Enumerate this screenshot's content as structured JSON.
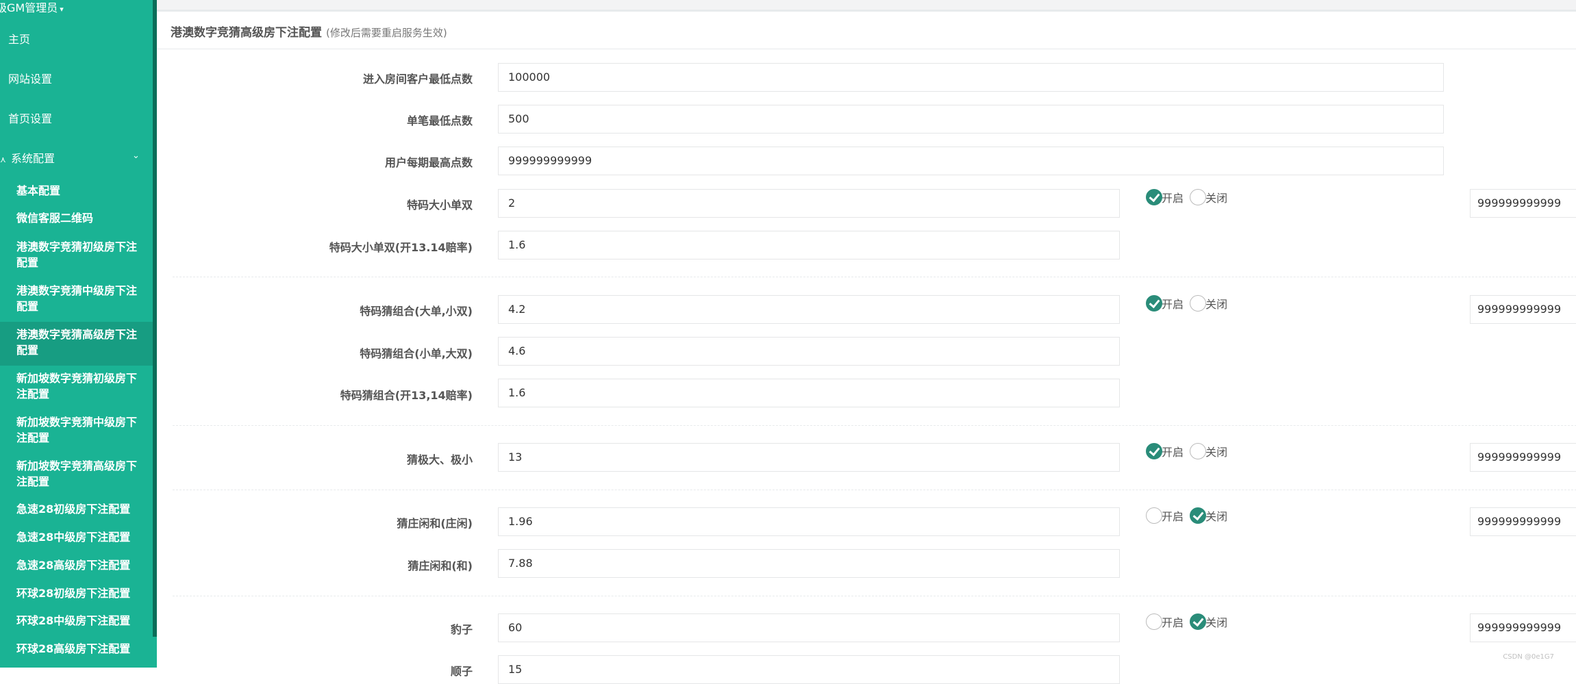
{
  "sidebar": {
    "user_label": "级GM管理员",
    "home": "主页",
    "site_settings": "网站设置",
    "homepage_settings": "首页设置",
    "system_config": "系统配置",
    "items": [
      "基本配置",
      "微信客服二维码",
      "港澳数字竞猜初级房下注配置",
      "港澳数字竞猜中级房下注配置",
      "港澳数字竞猜高级房下注配置",
      "新加坡数字竞猜初级房下注配置",
      "新加坡数字竞猜中级房下注配置",
      "新加坡数字竞猜高级房下注配置",
      "急速28初级房下注配置",
      "急速28中级房下注配置",
      "急速28高级房下注配置",
      "环球28初级房下注配置",
      "环球28中级房下注配置",
      "环球28高级房下注配置"
    ],
    "active_index": 4
  },
  "panel": {
    "title": "港澳数字竞猜高级房下注配置",
    "note": "(修改后需要重启服务生效)"
  },
  "radio_labels": {
    "on": "开启",
    "off": "关闭"
  },
  "fields": {
    "min_entry_points": {
      "label": "进入房间客户最低点数",
      "value": "100000"
    },
    "min_bet_points": {
      "label": "单笔最低点数",
      "value": "500"
    },
    "max_user_points": {
      "label": "用户每期最高点数",
      "value": "999999999999"
    },
    "special_bsoe": {
      "label": "特码大小单双",
      "value": "2",
      "enabled": true,
      "max": "999999999999"
    },
    "special_bsoe_1314": {
      "label": "特码大小单双(开13.14赔率)",
      "value": "1.6"
    },
    "combo_big_odd": {
      "label": "特码猜组合(大单,小双)",
      "value": "4.2",
      "enabled": true,
      "max": "999999999999"
    },
    "combo_small_odd": {
      "label": "特码猜组合(小单,大双)",
      "value": "4.6"
    },
    "combo_1314": {
      "label": "特码猜组合(开13,14赔率)",
      "value": "1.6"
    },
    "extreme": {
      "label": "猜极大、极小",
      "value": "13",
      "enabled": true,
      "max": "999999999999"
    },
    "banker_player": {
      "label": "猜庄闲和(庄闲)",
      "value": "1.96",
      "enabled": false,
      "max": "999999999999"
    },
    "tie": {
      "label": "猜庄闲和(和)",
      "value": "7.88"
    },
    "leopard": {
      "label": "豹子",
      "value": "60",
      "enabled": false,
      "max": "999999999999"
    },
    "straight": {
      "label": "顺子",
      "value": "15"
    }
  },
  "watermark": "CSDN @0e1G7"
}
